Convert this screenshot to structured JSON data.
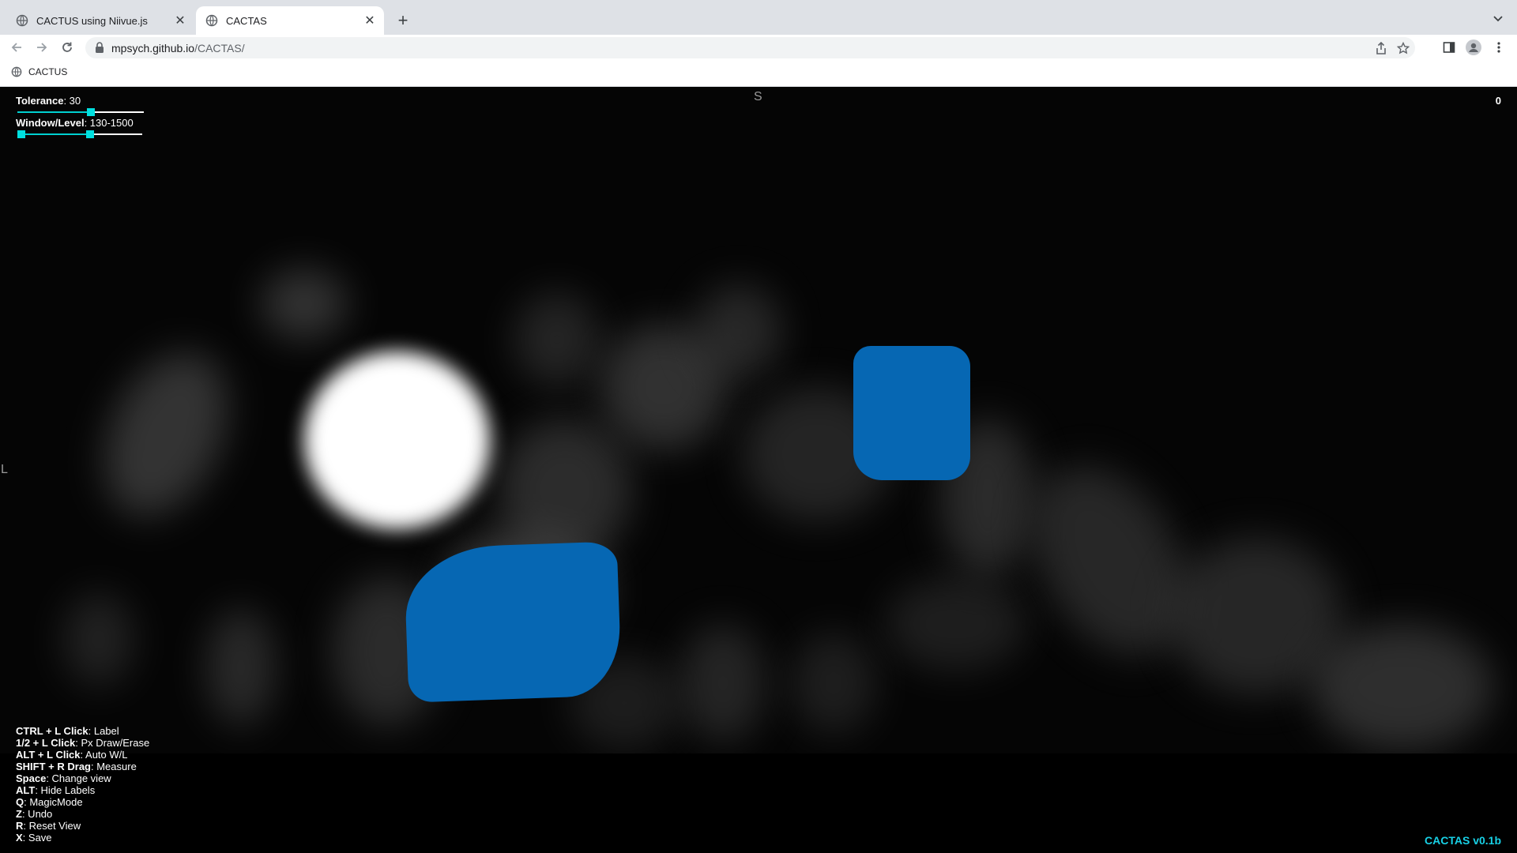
{
  "browser": {
    "tabs": [
      {
        "title": "CACTUS using Niivue.js",
        "active": false
      },
      {
        "title": "CACTAS",
        "active": true
      }
    ],
    "url_host": "mpsych.github.io",
    "url_path": "/CACTAS/",
    "bookmarks": [
      {
        "label": "CACTUS"
      }
    ]
  },
  "app": {
    "tolerance": {
      "label": "Tolerance",
      "value": ": 30",
      "level": 0.58
    },
    "window_level": {
      "label": "Window/Level",
      "value": ": 130-1500",
      "low": 0.03,
      "high": 0.58
    },
    "orientation": {
      "top": "S",
      "left": "L"
    },
    "counter": "0",
    "version": "CACTAS v0.1b",
    "help": [
      {
        "key": "CTRL + L Click",
        "desc": ": Label"
      },
      {
        "key": "1/2 + L Click",
        "desc": ": Px Draw/Erase"
      },
      {
        "key": "ALT + L Click",
        "desc": ": Auto W/L"
      },
      {
        "key": "SHIFT + R Drag",
        "desc": ": Measure"
      },
      {
        "key": "Space",
        "desc": ": Change view"
      },
      {
        "key": "ALT",
        "desc": ": Hide Labels"
      },
      {
        "key": "Q",
        "desc": ": MagicMode"
      },
      {
        "key": "Z",
        "desc": ": Undo"
      },
      {
        "key": "R",
        "desc": ": Reset View"
      },
      {
        "key": "X",
        "desc": ": Save"
      }
    ],
    "colors": {
      "label": "#0667b3",
      "accent": "#00e0e0",
      "version": "#18d1e6"
    }
  }
}
